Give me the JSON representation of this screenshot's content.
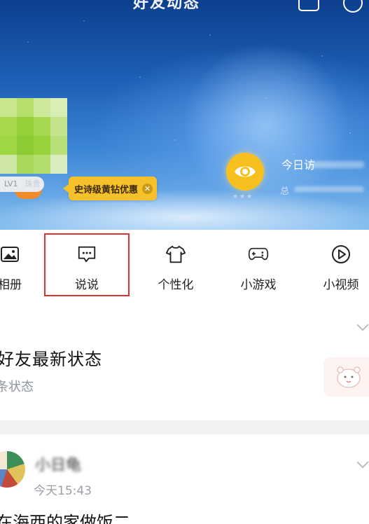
{
  "header": {
    "title": "好友动态",
    "level_tag": "LV1",
    "level_blur": "珠贵",
    "promo_pill": "史诗级黄钻优惠",
    "visitors_label": "今日访",
    "visitors_sub": "总"
  },
  "nav": {
    "items": [
      {
        "label": "相册",
        "icon": "photo-album-icon"
      },
      {
        "label": "说说",
        "icon": "chat-bubble-icon"
      },
      {
        "label": "个性化",
        "icon": "tshirt-icon"
      },
      {
        "label": "小游戏",
        "icon": "gamepad-icon"
      },
      {
        "label": "小视频",
        "icon": "play-circle-icon"
      }
    ],
    "highlighted": "说说"
  },
  "friend_status": {
    "title": "好友最新状态",
    "subtitle": "条状态"
  },
  "post": {
    "name": "小日龟",
    "time": "今天15:43",
    "text": "在海西的家做饭二"
  },
  "colors": {
    "accent_yellow": "#f6c12a",
    "highlight_red": "#e03131"
  }
}
